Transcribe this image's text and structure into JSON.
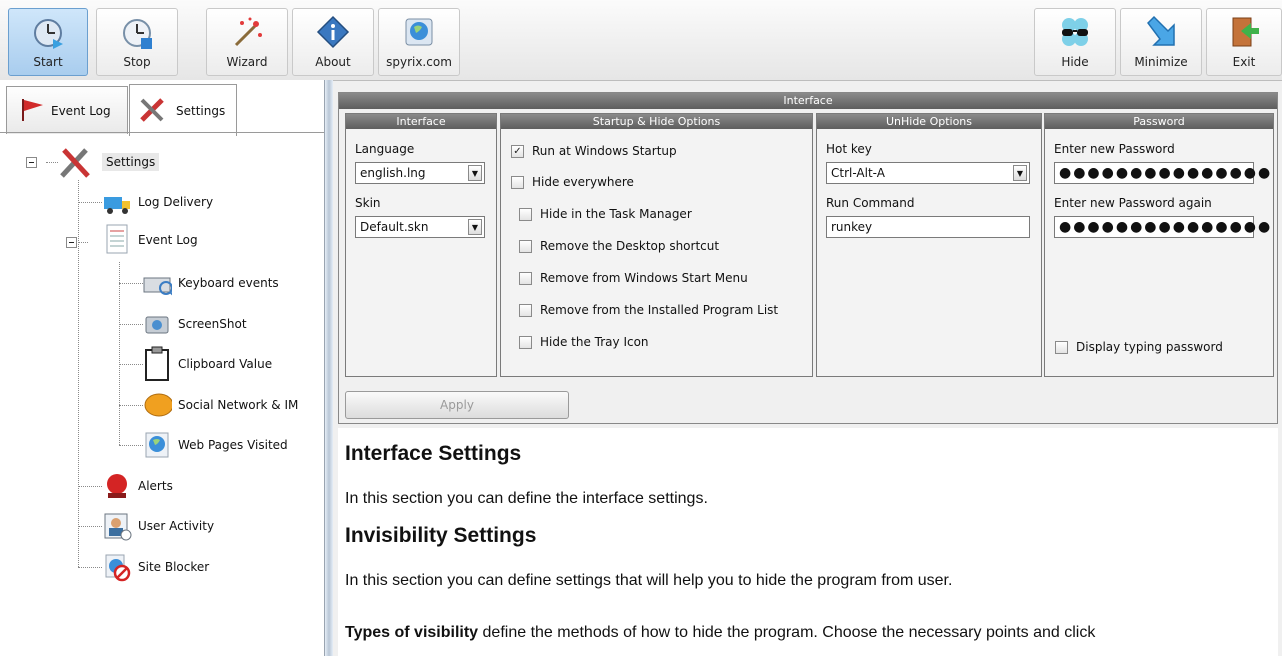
{
  "toolbar": {
    "start": "Start",
    "stop": "Stop",
    "wizard": "Wizard",
    "about": "About",
    "site": "spyrix.com",
    "hide": "Hide",
    "minimize": "Minimize",
    "exit": "Exit"
  },
  "tabs": {
    "event_log": "Event Log",
    "settings": "Settings"
  },
  "tree": {
    "settings": "Settings",
    "log_delivery": "Log Delivery",
    "event_log": "Event Log",
    "keyboard_events": "Keyboard events",
    "screenshot": "ScreenShot",
    "clipboard": "Clipboard Value",
    "social": "Social Network & IM",
    "web_pages": "Web Pages Visited",
    "alerts": "Alerts",
    "user_activity": "User Activity",
    "site_blocker": "Site Blocker"
  },
  "interface_group": {
    "title": "Interface",
    "interface_panel": {
      "title": "Interface",
      "language_label": "Language",
      "language_value": "english.lng",
      "skin_label": "Skin",
      "skin_value": "Default.skn"
    },
    "startup_panel": {
      "title": "Startup & Hide Options",
      "options": [
        {
          "label": "Run at Windows Startup",
          "checked": true
        },
        {
          "label": "Hide everywhere",
          "checked": false
        },
        {
          "label": "Hide in the Task Manager",
          "checked": false
        },
        {
          "label": "Remove the Desktop shortcut",
          "checked": false
        },
        {
          "label": "Remove from Windows Start Menu",
          "checked": false
        },
        {
          "label": "Remove from the Installed Program List",
          "checked": false
        },
        {
          "label": "Hide the Tray Icon",
          "checked": false
        }
      ]
    },
    "unhide_panel": {
      "title": "UnHide Options",
      "hotkey_label": "Hot key",
      "hotkey_value": "Ctrl-Alt-A",
      "run_label": "Run Command",
      "run_value": "runkey"
    },
    "password_panel": {
      "title": "Password",
      "new_label": "Enter new Password",
      "new_value": "●●●●●●●●●●●●●●●",
      "again_label": "Enter new Password again",
      "again_value": "●●●●●●●●●●●●●●●",
      "display_label": "Display typing password"
    },
    "apply": "Apply"
  },
  "help": {
    "h1": "Interface Settings",
    "p1": "In this section you can define the interface settings.",
    "h2": "Invisibility Settings",
    "p2": "In this section you can define settings that will help you to hide the program from user.",
    "p3_bold": "Types of visibility",
    "p3_rest": " define the methods of how to hide the program. Choose the necessary points and click"
  }
}
